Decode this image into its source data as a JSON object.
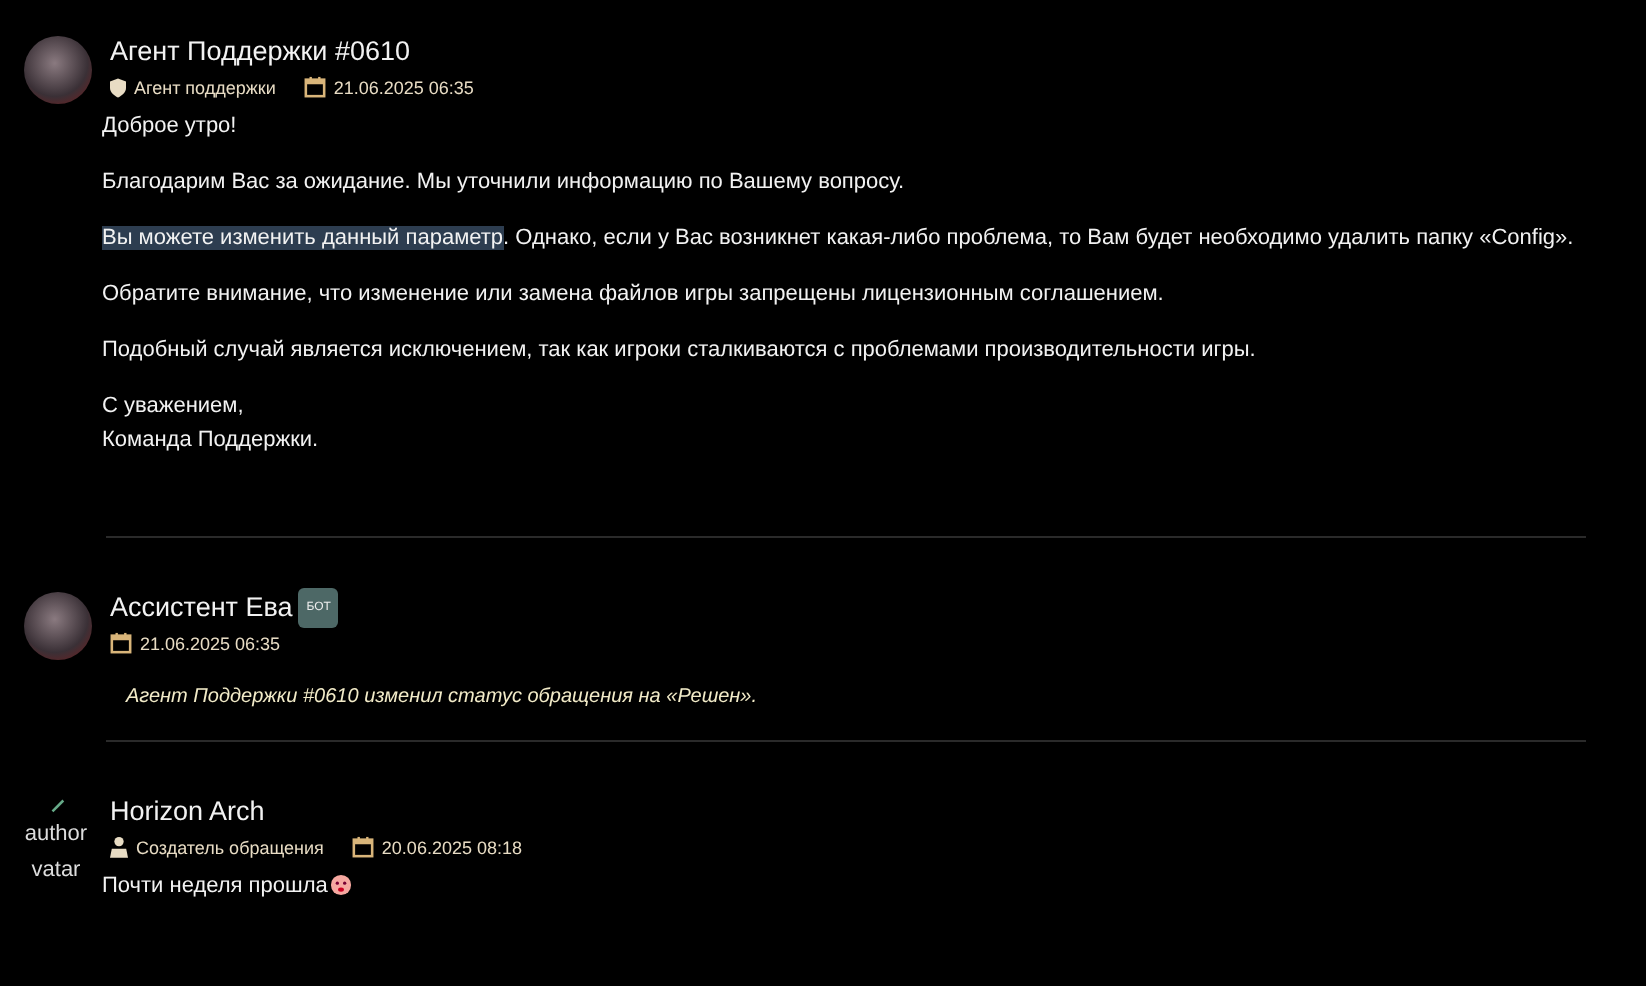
{
  "posts": [
    {
      "author": "Агент Поддержки #0610",
      "avatar": {
        "kind": "photo"
      },
      "role": {
        "kind": "shield",
        "label": "Агент поддержки"
      },
      "date": "21.06.2025 06:35",
      "paragraphs": [
        {
          "lines": [
            "Доброе утро!"
          ]
        },
        {
          "lines": [
            "Благодарим Вас за ожидание. Мы уточнили информацию по Вашему вопросу."
          ]
        },
        {
          "selected_text": "Вы можете изменить данный параметр",
          "lines": [
            ". Однако, если у Вас возникнет какая-либо проблема, то Вам будет необходимо удалить папку «Config»."
          ]
        },
        {
          "lines": [
            "Обратите внимание, что изменение или замена файлов игры запрещены лицензионным соглашением."
          ]
        },
        {
          "lines": [
            "Подобный случай является исключением, так как игроки сталкиваются с проблемами производительности игры."
          ]
        },
        {
          "lines": [
            "С уважением,",
            "Команда Поддержки."
          ]
        }
      ]
    },
    {
      "author": "Ассистент Ева",
      "badge": "БОТ",
      "avatar": {
        "kind": "photo"
      },
      "date": "21.06.2025 06:35",
      "system_message": "Агент Поддержки #0610 изменил статус обращения на «Решен»."
    },
    {
      "author": "Horizon Arch",
      "avatar": {
        "kind": "broken",
        "alt": "author vatar"
      },
      "role": {
        "kind": "person",
        "label": "Создатель обращения"
      },
      "date": "20.06.2025 08:18",
      "paragraphs": [
        {
          "lines": [
            "Почти неделя прошла"
          ],
          "emoji": true
        }
      ]
    }
  ]
}
